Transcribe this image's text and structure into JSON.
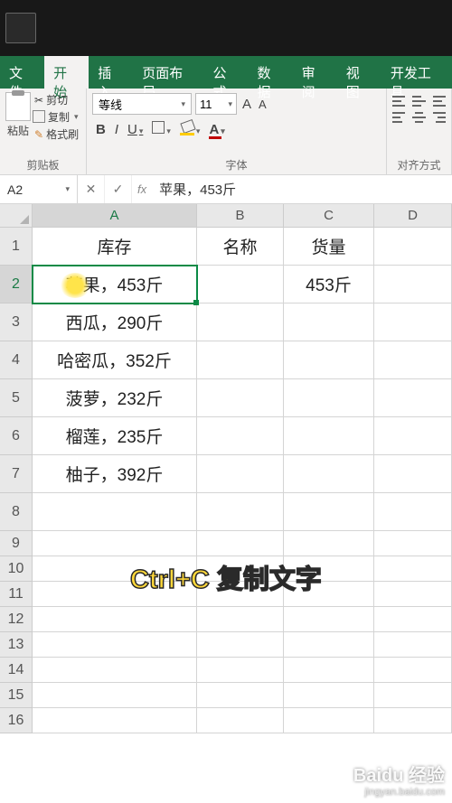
{
  "ribbon_tabs": {
    "file": "文件",
    "home": "开始",
    "insert": "插入",
    "layout": "页面布局",
    "formulas": "公式",
    "data": "数据",
    "review": "审阅",
    "view": "视图",
    "dev": "开发工具"
  },
  "clipboard": {
    "paste": "粘贴",
    "cut": "剪切",
    "copy": "复制",
    "format_painter": "格式刷",
    "group_label": "剪贴板"
  },
  "font": {
    "name": "等线",
    "size": "11",
    "group_label": "字体"
  },
  "align": {
    "group_label": "对齐方式"
  },
  "name_box": "A2",
  "formula_value": "苹果，453斤",
  "columns": [
    "A",
    "B",
    "C",
    "D"
  ],
  "headers": {
    "A": "库存",
    "B": "名称",
    "C": "货量"
  },
  "chart_data": {
    "type": "table",
    "columns": [
      "库存",
      "名称",
      "货量"
    ],
    "rows": [
      {
        "A": "苹果，453斤",
        "B": "",
        "C": "453斤"
      },
      {
        "A": "西瓜，290斤",
        "B": "",
        "C": ""
      },
      {
        "A": "哈密瓜，352斤",
        "B": "",
        "C": ""
      },
      {
        "A": "菠萝，232斤",
        "B": "",
        "C": ""
      },
      {
        "A": "榴莲，235斤",
        "B": "",
        "C": ""
      },
      {
        "A": "柚子，392斤",
        "B": "",
        "C": ""
      }
    ]
  },
  "row_numbers": [
    "1",
    "2",
    "3",
    "4",
    "5",
    "6",
    "7",
    "8",
    "9",
    "10",
    "11",
    "12",
    "13",
    "14",
    "15",
    "16"
  ],
  "overlay": "Ctrl+C 复制文字",
  "watermark": {
    "logo": "Baidu 经验",
    "url": "jingyan.baidu.com"
  }
}
